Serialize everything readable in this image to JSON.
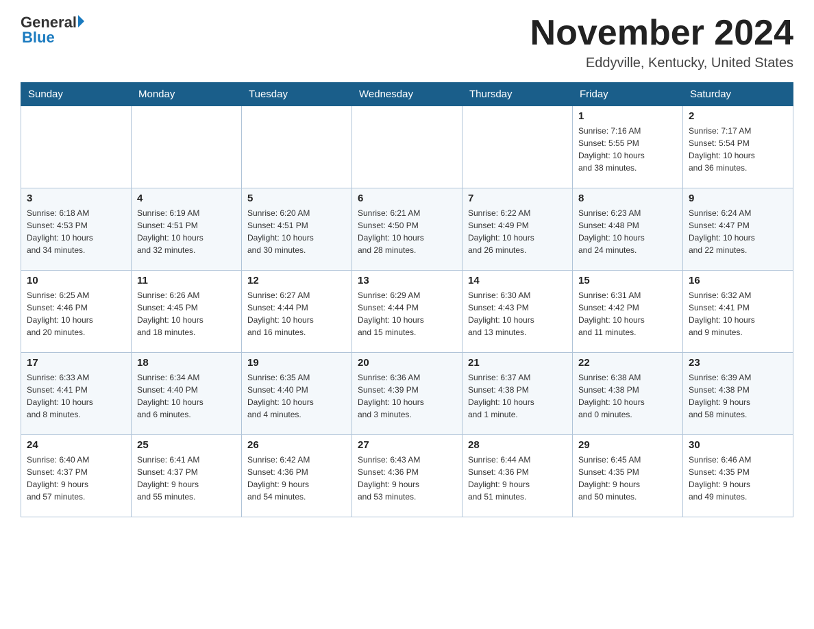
{
  "header": {
    "logo_general": "General",
    "logo_blue": "Blue",
    "month_title": "November 2024",
    "location": "Eddyville, Kentucky, United States"
  },
  "days_of_week": [
    "Sunday",
    "Monday",
    "Tuesday",
    "Wednesday",
    "Thursday",
    "Friday",
    "Saturday"
  ],
  "weeks": [
    [
      {
        "day": "",
        "info": ""
      },
      {
        "day": "",
        "info": ""
      },
      {
        "day": "",
        "info": ""
      },
      {
        "day": "",
        "info": ""
      },
      {
        "day": "",
        "info": ""
      },
      {
        "day": "1",
        "info": "Sunrise: 7:16 AM\nSunset: 5:55 PM\nDaylight: 10 hours\nand 38 minutes."
      },
      {
        "day": "2",
        "info": "Sunrise: 7:17 AM\nSunset: 5:54 PM\nDaylight: 10 hours\nand 36 minutes."
      }
    ],
    [
      {
        "day": "3",
        "info": "Sunrise: 6:18 AM\nSunset: 4:53 PM\nDaylight: 10 hours\nand 34 minutes."
      },
      {
        "day": "4",
        "info": "Sunrise: 6:19 AM\nSunset: 4:51 PM\nDaylight: 10 hours\nand 32 minutes."
      },
      {
        "day": "5",
        "info": "Sunrise: 6:20 AM\nSunset: 4:51 PM\nDaylight: 10 hours\nand 30 minutes."
      },
      {
        "day": "6",
        "info": "Sunrise: 6:21 AM\nSunset: 4:50 PM\nDaylight: 10 hours\nand 28 minutes."
      },
      {
        "day": "7",
        "info": "Sunrise: 6:22 AM\nSunset: 4:49 PM\nDaylight: 10 hours\nand 26 minutes."
      },
      {
        "day": "8",
        "info": "Sunrise: 6:23 AM\nSunset: 4:48 PM\nDaylight: 10 hours\nand 24 minutes."
      },
      {
        "day": "9",
        "info": "Sunrise: 6:24 AM\nSunset: 4:47 PM\nDaylight: 10 hours\nand 22 minutes."
      }
    ],
    [
      {
        "day": "10",
        "info": "Sunrise: 6:25 AM\nSunset: 4:46 PM\nDaylight: 10 hours\nand 20 minutes."
      },
      {
        "day": "11",
        "info": "Sunrise: 6:26 AM\nSunset: 4:45 PM\nDaylight: 10 hours\nand 18 minutes."
      },
      {
        "day": "12",
        "info": "Sunrise: 6:27 AM\nSunset: 4:44 PM\nDaylight: 10 hours\nand 16 minutes."
      },
      {
        "day": "13",
        "info": "Sunrise: 6:29 AM\nSunset: 4:44 PM\nDaylight: 10 hours\nand 15 minutes."
      },
      {
        "day": "14",
        "info": "Sunrise: 6:30 AM\nSunset: 4:43 PM\nDaylight: 10 hours\nand 13 minutes."
      },
      {
        "day": "15",
        "info": "Sunrise: 6:31 AM\nSunset: 4:42 PM\nDaylight: 10 hours\nand 11 minutes."
      },
      {
        "day": "16",
        "info": "Sunrise: 6:32 AM\nSunset: 4:41 PM\nDaylight: 10 hours\nand 9 minutes."
      }
    ],
    [
      {
        "day": "17",
        "info": "Sunrise: 6:33 AM\nSunset: 4:41 PM\nDaylight: 10 hours\nand 8 minutes."
      },
      {
        "day": "18",
        "info": "Sunrise: 6:34 AM\nSunset: 4:40 PM\nDaylight: 10 hours\nand 6 minutes."
      },
      {
        "day": "19",
        "info": "Sunrise: 6:35 AM\nSunset: 4:40 PM\nDaylight: 10 hours\nand 4 minutes."
      },
      {
        "day": "20",
        "info": "Sunrise: 6:36 AM\nSunset: 4:39 PM\nDaylight: 10 hours\nand 3 minutes."
      },
      {
        "day": "21",
        "info": "Sunrise: 6:37 AM\nSunset: 4:38 PM\nDaylight: 10 hours\nand 1 minute."
      },
      {
        "day": "22",
        "info": "Sunrise: 6:38 AM\nSunset: 4:38 PM\nDaylight: 10 hours\nand 0 minutes."
      },
      {
        "day": "23",
        "info": "Sunrise: 6:39 AM\nSunset: 4:38 PM\nDaylight: 9 hours\nand 58 minutes."
      }
    ],
    [
      {
        "day": "24",
        "info": "Sunrise: 6:40 AM\nSunset: 4:37 PM\nDaylight: 9 hours\nand 57 minutes."
      },
      {
        "day": "25",
        "info": "Sunrise: 6:41 AM\nSunset: 4:37 PM\nDaylight: 9 hours\nand 55 minutes."
      },
      {
        "day": "26",
        "info": "Sunrise: 6:42 AM\nSunset: 4:36 PM\nDaylight: 9 hours\nand 54 minutes."
      },
      {
        "day": "27",
        "info": "Sunrise: 6:43 AM\nSunset: 4:36 PM\nDaylight: 9 hours\nand 53 minutes."
      },
      {
        "day": "28",
        "info": "Sunrise: 6:44 AM\nSunset: 4:36 PM\nDaylight: 9 hours\nand 51 minutes."
      },
      {
        "day": "29",
        "info": "Sunrise: 6:45 AM\nSunset: 4:35 PM\nDaylight: 9 hours\nand 50 minutes."
      },
      {
        "day": "30",
        "info": "Sunrise: 6:46 AM\nSunset: 4:35 PM\nDaylight: 9 hours\nand 49 minutes."
      }
    ]
  ]
}
